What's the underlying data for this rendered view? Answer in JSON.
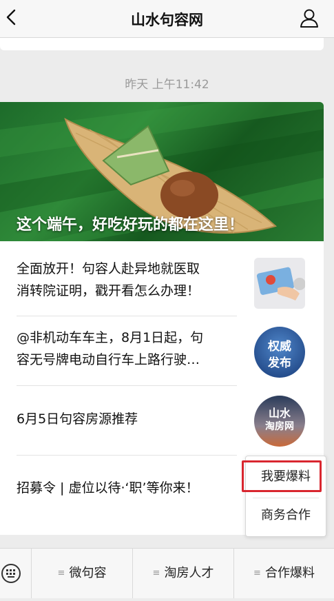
{
  "header": {
    "title": "山水句容网"
  },
  "timestamp": "昨天 上午11:42",
  "hero": {
    "caption": "这个端午，好吃好玩的都在这里！"
  },
  "articles": [
    {
      "line1": "全面放开！句容人赴异地就医取",
      "line2": "消转院证明，戳开看怎么办理！"
    },
    {
      "line1": "@非机动车车主，8月1日起，句",
      "line2": "容无号牌电动自行车上路行驶…",
      "thumb_text1": "权威",
      "thumb_text2": "发布"
    },
    {
      "line1": "6月5日句容房源推荐",
      "thumb_text1": "山水",
      "thumb_text2": "淘房网"
    },
    {
      "line1": "招募令 | 虚位以待·‘职’等你来！"
    }
  ],
  "popup": {
    "items": [
      "我要爆料",
      "商务合作"
    ]
  },
  "bottom_tabs": [
    "微句容",
    "淘房人才",
    "合作爆料"
  ],
  "colors": {
    "highlight": "#d9262f",
    "hero_green": "#2f8a39"
  }
}
